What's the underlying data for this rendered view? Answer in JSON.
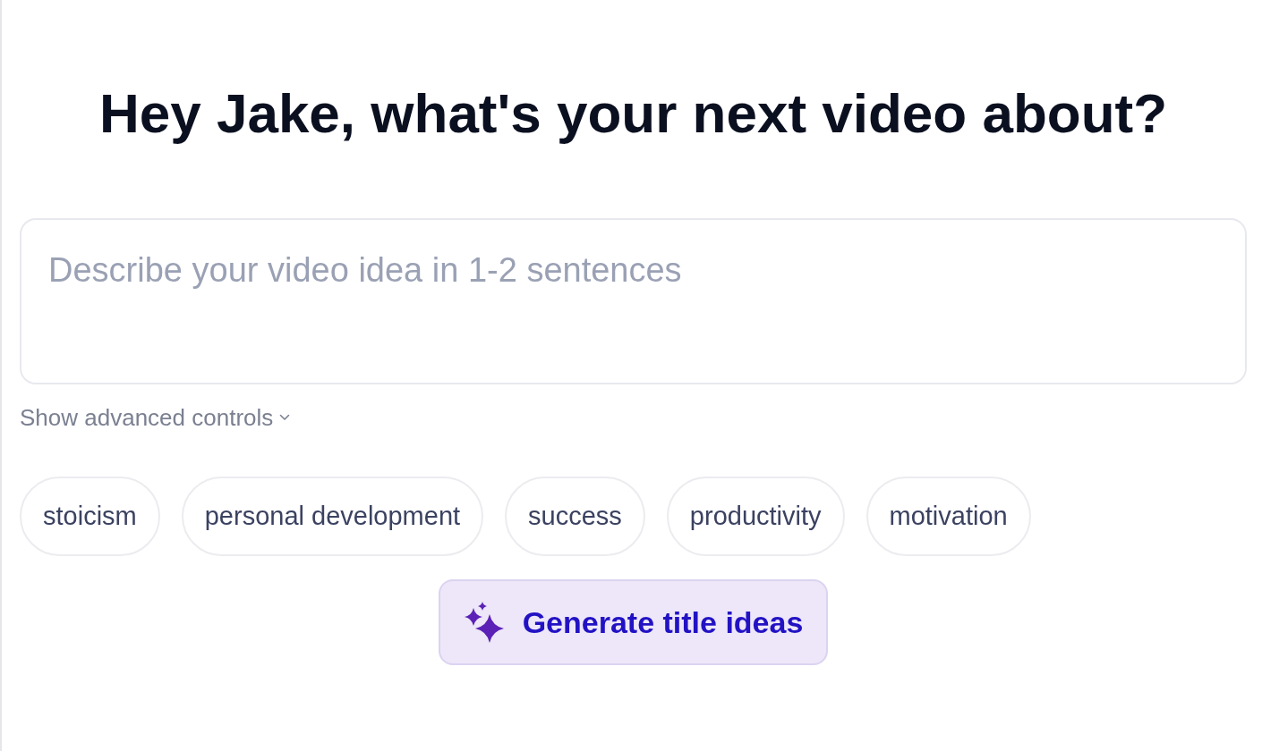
{
  "heading": "Hey Jake, what's your next video about?",
  "idea_field": {
    "placeholder": "Describe your video idea in 1-2 sentences"
  },
  "advanced_toggle": {
    "label": "Show advanced controls",
    "expanded": false
  },
  "topic_chips": [
    {
      "label": "stoicism"
    },
    {
      "label": "personal development"
    },
    {
      "label": "success"
    },
    {
      "label": "productivity"
    },
    {
      "label": "motivation"
    }
  ],
  "generate_button": {
    "label": "Generate title ideas"
  }
}
